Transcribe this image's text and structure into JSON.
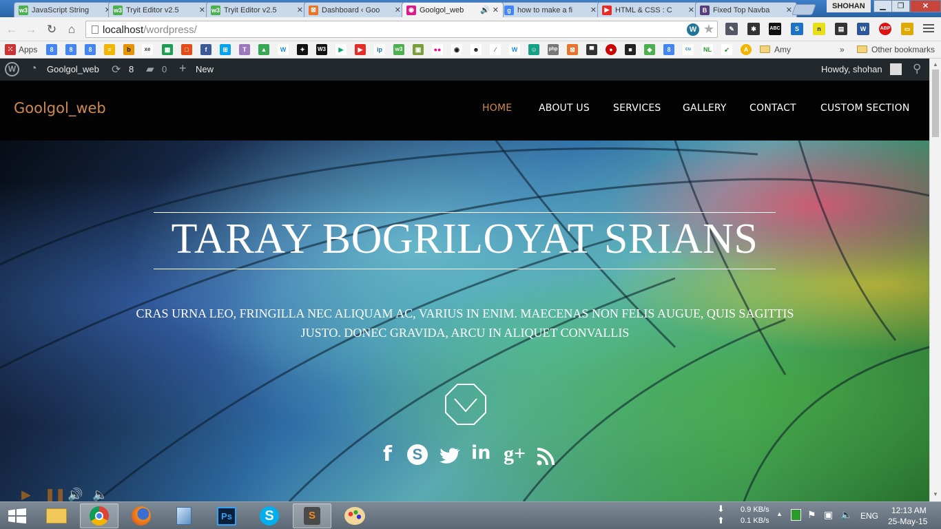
{
  "browser": {
    "tabs": [
      {
        "title": "JavaScript String",
        "favicon": "w3schools-icon",
        "color": "#4caf50",
        "glyph": "w3"
      },
      {
        "title": "Tryit Editor v2.5",
        "favicon": "w3schools-icon",
        "color": "#4caf50",
        "glyph": "w3"
      },
      {
        "title": "Tryit Editor v2.5",
        "favicon": "w3schools-icon",
        "color": "#4caf50",
        "glyph": "w3"
      },
      {
        "title": "Dashboard ‹ Goo",
        "favicon": "xampp-icon",
        "color": "#e8742a",
        "glyph": "⊠"
      },
      {
        "title": "Goolgol_web",
        "favicon": "site-icon",
        "color": "#d81b86",
        "glyph": "◉",
        "active": true,
        "audio": true
      },
      {
        "title": "how to make a fi",
        "favicon": "google-icon",
        "color": "#4285f4",
        "glyph": "g"
      },
      {
        "title": "HTML & CSS : C",
        "favicon": "youtube-icon",
        "color": "#e52d27",
        "glyph": "▶"
      },
      {
        "title": "Fixed Top Navba",
        "favicon": "bootstrap-icon",
        "color": "#563d7c",
        "glyph": "B"
      }
    ],
    "profile_name": "SHOHAN",
    "url_host": "localhost",
    "url_path": "/wordpress/",
    "bookmarks_apps_label": "Apps",
    "bookmark_amy": "Amy",
    "more_label": "»",
    "other_bookmarks": "Other bookmarks"
  },
  "adminbar": {
    "site_name": "Goolgol_web",
    "updates_count": "8",
    "comments_count": "0",
    "new_label": "New",
    "howdy": "Howdy, shohan"
  },
  "site": {
    "brand": "Goolgol_web",
    "nav": [
      "HOME",
      "ABOUT US",
      "SERVICES",
      "GALLERY",
      "CONTACT",
      "CUSTOM SECTION"
    ],
    "active_nav": "HOME",
    "accent": "#d08a4c",
    "hero_title": "TARAY BOGRILOYAT SRIANS",
    "hero_subtitle": "CRAS URNA LEO, FRINGILLA NEC ALIQUAM AC, VARIUS IN ENIM. MAECENAS NON FELIS AUGUE, QUIS SAGITTIS JUSTO. DONEC GRAVIDA, ARCU IN ALIQUET CONVALLIS",
    "social": [
      "facebook-icon",
      "skype-icon",
      "twitter-icon",
      "linkedin-icon",
      "googleplus-icon",
      "rss-icon"
    ]
  },
  "taskbar": {
    "download_speed": "0.9 KB/s",
    "upload_speed": "0.1 KB/s",
    "language": "ENG",
    "time": "12:13 AM",
    "date": "25-May-15"
  }
}
